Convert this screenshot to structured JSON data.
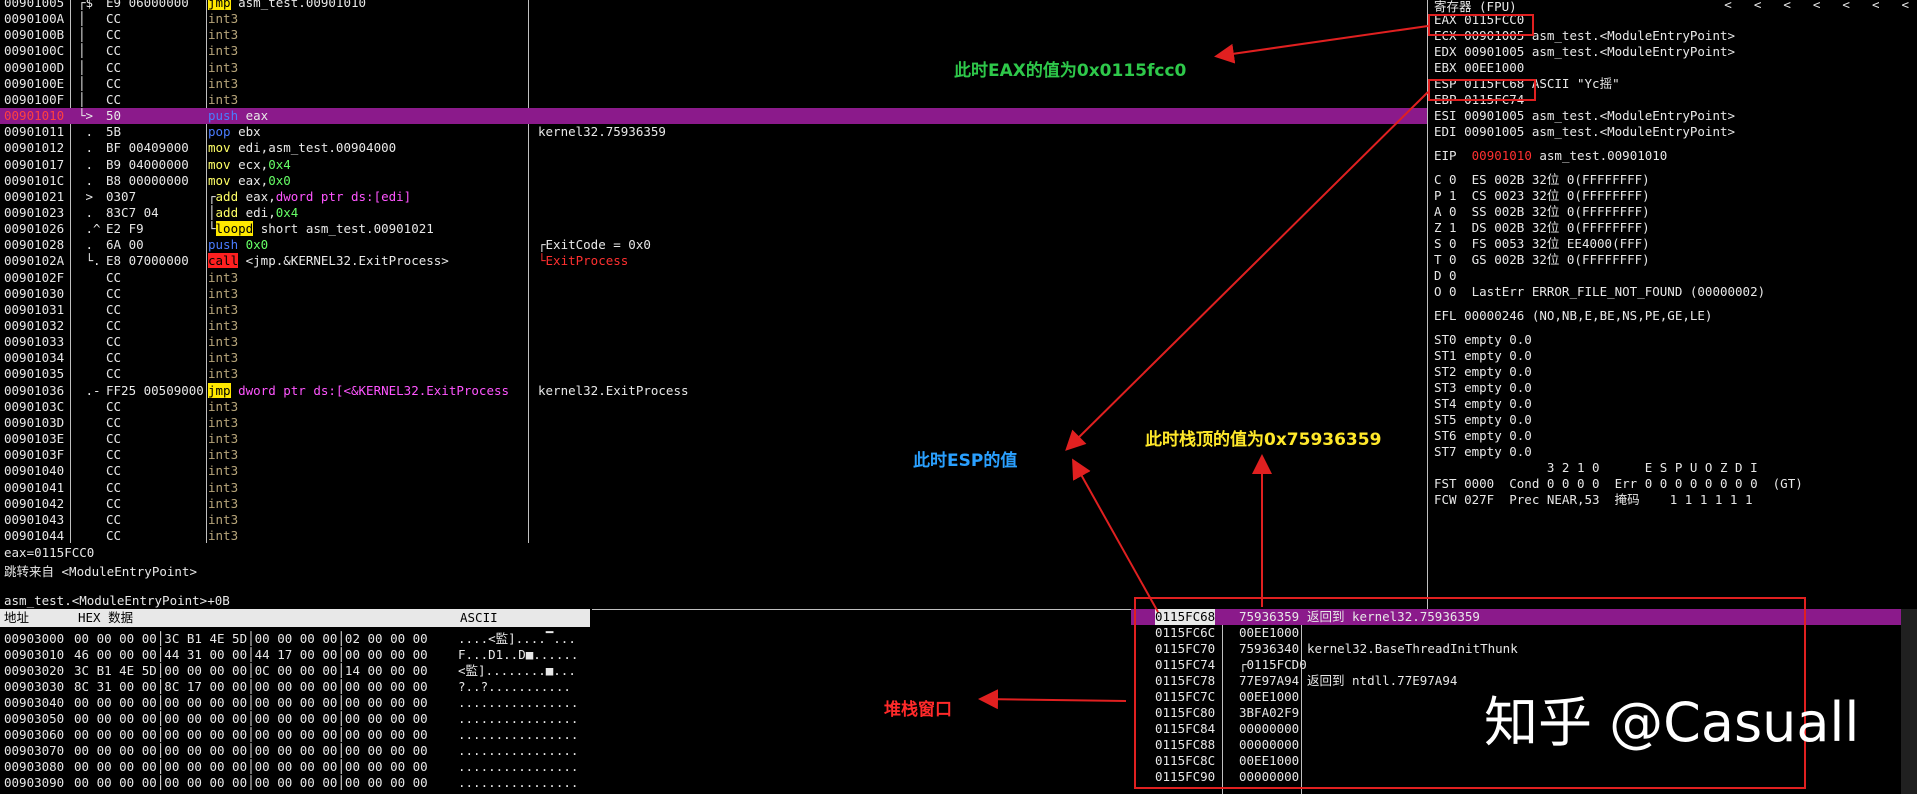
{
  "cpu": {
    "rows": [
      {
        "addr": "00901005",
        "mark": "┌$",
        "hex": "E9 06000000",
        "dis": [
          {
            "t": "jmp",
            "c": "kw-jmp"
          },
          {
            "t": " asm_test.00901010"
          }
        ],
        "com": ""
      },
      {
        "addr": "0090100A",
        "mark": "│",
        "hex": "CC",
        "dis": [
          {
            "t": "int3",
            "c": "kw-int"
          }
        ],
        "com": ""
      },
      {
        "addr": "0090100B",
        "mark": "│",
        "hex": "CC",
        "dis": [
          {
            "t": "int3",
            "c": "kw-int"
          }
        ],
        "com": ""
      },
      {
        "addr": "0090100C",
        "mark": "│",
        "hex": "CC",
        "dis": [
          {
            "t": "int3",
            "c": "kw-int"
          }
        ],
        "com": ""
      },
      {
        "addr": "0090100D",
        "mark": "│",
        "hex": "CC",
        "dis": [
          {
            "t": "int3",
            "c": "kw-int"
          }
        ],
        "com": ""
      },
      {
        "addr": "0090100E",
        "mark": "│",
        "hex": "CC",
        "dis": [
          {
            "t": "int3",
            "c": "kw-int"
          }
        ],
        "com": ""
      },
      {
        "addr": "0090100F",
        "mark": "│",
        "hex": "CC",
        "dis": [
          {
            "t": "int3",
            "c": "kw-int"
          }
        ],
        "com": ""
      },
      {
        "addr": "00901010",
        "mark": "└>",
        "hex": "50",
        "dis": [
          {
            "t": "push",
            "c": "kw-push"
          },
          {
            "t": " eax"
          }
        ],
        "com": "",
        "hl": true
      },
      {
        "addr": "00901011",
        "mark": " .",
        "hex": "5B",
        "dis": [
          {
            "t": "pop",
            "c": "kw-pop"
          },
          {
            "t": " ebx"
          }
        ],
        "com": "kernel32.75936359"
      },
      {
        "addr": "00901012",
        "mark": " .",
        "hex": "BF 00409000",
        "dis": [
          {
            "t": "mov",
            "c": "kw-mov"
          },
          {
            "t": " edi,asm_test.00904000"
          }
        ],
        "com": ""
      },
      {
        "addr": "00901017",
        "mark": " .",
        "hex": "B9 04000000",
        "dis": [
          {
            "t": "mov",
            "c": "kw-mov"
          },
          {
            "t": " ecx,"
          },
          {
            "t": "0x4",
            "c": "num"
          }
        ],
        "com": ""
      },
      {
        "addr": "0090101C",
        "mark": " .",
        "hex": "B8 00000000",
        "dis": [
          {
            "t": "mov",
            "c": "kw-mov"
          },
          {
            "t": " eax,"
          },
          {
            "t": "0x0",
            "c": "num"
          }
        ],
        "com": ""
      },
      {
        "addr": "00901021",
        "mark": " >",
        "hex": "0307",
        "dis": [
          {
            "t": "┌"
          },
          {
            "t": "add",
            "c": "kw-add"
          },
          {
            "t": " eax,"
          },
          {
            "t": "dword ptr ds:[edi]",
            "c": "mem"
          }
        ],
        "com": ""
      },
      {
        "addr": "00901023",
        "mark": " .",
        "hex": "83C7 04",
        "dis": [
          {
            "t": "│"
          },
          {
            "t": "add",
            "c": "kw-add"
          },
          {
            "t": " edi,"
          },
          {
            "t": "0x4",
            "c": "num"
          }
        ],
        "com": ""
      },
      {
        "addr": "00901026",
        "mark": " .^",
        "hex": "E2 F9",
        "dis": [
          {
            "t": "└"
          },
          {
            "t": "loopd",
            "c": "kw-loop"
          },
          {
            "t": " short asm_test.00901021"
          }
        ],
        "com": ""
      },
      {
        "addr": "00901028",
        "mark": " .",
        "hex": "6A 00",
        "dis": [
          {
            "t": "push",
            "c": "kw-push"
          },
          {
            "t": " 0x0",
            "c": "num"
          }
        ],
        "com": "┌ExitCode = 0x0"
      },
      {
        "addr": "0090102A",
        "mark": " └.",
        "hex": "E8 07000000",
        "dis": [
          {
            "t": "call",
            "c": "kw-call"
          },
          {
            "t": " <jmp.&KERNEL32.ExitProcess>"
          }
        ],
        "com": "└ExitProcess",
        "comred": true
      },
      {
        "addr": "0090102F",
        "mark": "",
        "hex": "CC",
        "dis": [
          {
            "t": "int3",
            "c": "kw-int"
          }
        ],
        "com": ""
      },
      {
        "addr": "00901030",
        "mark": "",
        "hex": "CC",
        "dis": [
          {
            "t": "int3",
            "c": "kw-int"
          }
        ],
        "com": ""
      },
      {
        "addr": "00901031",
        "mark": "",
        "hex": "CC",
        "dis": [
          {
            "t": "int3",
            "c": "kw-int"
          }
        ],
        "com": ""
      },
      {
        "addr": "00901032",
        "mark": "",
        "hex": "CC",
        "dis": [
          {
            "t": "int3",
            "c": "kw-int"
          }
        ],
        "com": ""
      },
      {
        "addr": "00901033",
        "mark": "",
        "hex": "CC",
        "dis": [
          {
            "t": "int3",
            "c": "kw-int"
          }
        ],
        "com": ""
      },
      {
        "addr": "00901034",
        "mark": "",
        "hex": "CC",
        "dis": [
          {
            "t": "int3",
            "c": "kw-int"
          }
        ],
        "com": ""
      },
      {
        "addr": "00901035",
        "mark": "",
        "hex": "CC",
        "dis": [
          {
            "t": "int3",
            "c": "kw-int"
          }
        ],
        "com": ""
      },
      {
        "addr": "00901036",
        "mark": " .-",
        "hex": "FF25 00509000",
        "dis": [
          {
            "t": "jmp",
            "c": "kw-jmp"
          },
          {
            "t": " dword ptr ds:[<&KERNEL32.ExitProcess",
            "c": "mem"
          }
        ],
        "com": "kernel32.ExitProcess"
      },
      {
        "addr": "0090103C",
        "mark": "",
        "hex": "CC",
        "dis": [
          {
            "t": "int3",
            "c": "kw-int"
          }
        ],
        "com": ""
      },
      {
        "addr": "0090103D",
        "mark": "",
        "hex": "CC",
        "dis": [
          {
            "t": "int3",
            "c": "kw-int"
          }
        ],
        "com": ""
      },
      {
        "addr": "0090103E",
        "mark": "",
        "hex": "CC",
        "dis": [
          {
            "t": "int3",
            "c": "kw-int"
          }
        ],
        "com": ""
      },
      {
        "addr": "0090103F",
        "mark": "",
        "hex": "CC",
        "dis": [
          {
            "t": "int3",
            "c": "kw-int"
          }
        ],
        "com": ""
      },
      {
        "addr": "00901040",
        "mark": "",
        "hex": "CC",
        "dis": [
          {
            "t": "int3",
            "c": "kw-int"
          }
        ],
        "com": ""
      },
      {
        "addr": "00901041",
        "mark": "",
        "hex": "CC",
        "dis": [
          {
            "t": "int3",
            "c": "kw-int"
          }
        ],
        "com": ""
      },
      {
        "addr": "00901042",
        "mark": "",
        "hex": "CC",
        "dis": [
          {
            "t": "int3",
            "c": "kw-int"
          }
        ],
        "com": ""
      },
      {
        "addr": "00901043",
        "mark": "",
        "hex": "CC",
        "dis": [
          {
            "t": "int3",
            "c": "kw-int"
          }
        ],
        "com": ""
      },
      {
        "addr": "00901044",
        "mark": "",
        "hex": "CC",
        "dis": [
          {
            "t": "int3",
            "c": "kw-int"
          }
        ],
        "com": ""
      }
    ]
  },
  "info": {
    "line1": "eax=0115FCC0",
    "line2": "跳转来自 <ModuleEntryPoint>",
    "line3": "asm_test.<ModuleEntryPoint>+0B"
  },
  "registers": {
    "title": "寄存器 (FPU)",
    "lines": [
      "EAX 0115FCC0",
      "ECX 00901005 asm_test.<ModuleEntryPoint>",
      "EDX 00901005 asm_test.<ModuleEntryPoint>",
      "EBX 00EE1000",
      "ESP 0115FC68 ASCII \"Yc摇\"",
      "EBP 0115FC74",
      "ESI 00901005 asm_test.<ModuleEntryPoint>",
      "EDI 00901005 asm_test.<ModuleEntryPoint>",
      "",
      "EIP_LINE",
      "",
      "C 0  ES 002B 32位 0(FFFFFFFF)",
      "P 1  CS 0023 32位 0(FFFFFFFF)",
      "A 0  SS 002B 32位 0(FFFFFFFF)",
      "Z 1  DS 002B 32位 0(FFFFFFFF)",
      "S 0  FS 0053 32位 EE4000(FFF)",
      "T 0  GS 002B 32位 0(FFFFFFFF)",
      "D 0",
      "O 0  LastErr ERROR_FILE_NOT_FOUND (00000002)",
      "",
      "EFL 00000246 (NO,NB,E,BE,NS,PE,GE,LE)",
      "",
      "ST0 empty 0.0",
      "ST1 empty 0.0",
      "ST2 empty 0.0",
      "ST3 empty 0.0",
      "ST4 empty 0.0",
      "ST5 empty 0.0",
      "ST6 empty 0.0",
      "ST7 empty 0.0",
      "               3 2 1 0      E S P U O Z D I",
      "FST 0000  Cond 0 0 0 0  Err 0 0 0 0 0 0 0 0  (GT)",
      "FCW 027F  Prec NEAR,53  掩码    1 1 1 1 1 1"
    ],
    "eip_label": "EIP",
    "eip_addr": "00901010",
    "eip_sym": "asm_test.00901010"
  },
  "dump": {
    "headers": [
      "地址",
      "HEX 数据",
      "ASCII"
    ],
    "rows": [
      {
        "addr": "00903000",
        "hex": "00 00 00 00│3C B1 4E 5D│00 00 00 00│02 00 00 00",
        "ascii": "....<監]....▔..."
      },
      {
        "addr": "00903010",
        "hex": "46 00 00 00│44 31 00 00│44 17 00 00│00 00 00 00",
        "ascii": "F...D1..D■......"
      },
      {
        "addr": "00903020",
        "hex": "3C B1 4E 5D│00 00 00 00│0C 00 00 00│14 00 00 00",
        "ascii": "<監]........■..."
      },
      {
        "addr": "00903030",
        "hex": "8C 31 00 00│8C 17 00 00│00 00 00 00│00 00 00 00",
        "ascii": "?..?..........."
      },
      {
        "addr": "00903040",
        "hex": "00 00 00 00│00 00 00 00│00 00 00 00│00 00 00 00",
        "ascii": "................"
      },
      {
        "addr": "00903050",
        "hex": "00 00 00 00│00 00 00 00│00 00 00 00│00 00 00 00",
        "ascii": "................"
      },
      {
        "addr": "00903060",
        "hex": "00 00 00 00│00 00 00 00│00 00 00 00│00 00 00 00",
        "ascii": "................"
      },
      {
        "addr": "00903070",
        "hex": "00 00 00 00│00 00 00 00│00 00 00 00│00 00 00 00",
        "ascii": "................"
      },
      {
        "addr": "00903080",
        "hex": "00 00 00 00│00 00 00 00│00 00 00 00│00 00 00 00",
        "ascii": "................"
      },
      {
        "addr": "00903090",
        "hex": "00 00 00 00│00 00 00 00│00 00 00 00│00 00 00 00",
        "ascii": "................"
      }
    ]
  },
  "stack": {
    "rows": [
      {
        "addr": "0115FC68",
        "val": "75936359",
        "com": "返回到 kernel32.75936359",
        "hl": true
      },
      {
        "addr": "0115FC6C",
        "val": "00EE1000",
        "com": ""
      },
      {
        "addr": "0115FC70",
        "val": "75936340",
        "com": "kernel32.BaseThreadInitThunk"
      },
      {
        "addr": "0115FC74",
        "val": "┌0115FCD0",
        "com": ""
      },
      {
        "addr": "0115FC78",
        "val": "77E97A94",
        "com": "返回到 ntdll.77E97A94"
      },
      {
        "addr": "0115FC7C",
        "val": "00EE1000",
        "com": ""
      },
      {
        "addr": "0115FC80",
        "val": "3BFA02F9",
        "com": ""
      },
      {
        "addr": "0115FC84",
        "val": "00000000",
        "com": ""
      },
      {
        "addr": "0115FC88",
        "val": "00000000",
        "com": ""
      },
      {
        "addr": "0115FC8C",
        "val": "00EE1000",
        "com": ""
      },
      {
        "addr": "0115FC90",
        "val": "00000000",
        "com": ""
      }
    ]
  },
  "annotations": {
    "eax_note": "此时EAX的值为0x0115fcc0",
    "esp_note": "此时ESP的值",
    "stacktop_note": "此时栈顶的值为0x75936359",
    "stack_window_note": "堆栈窗口",
    "colors": {
      "green": "#2ec84a",
      "blue": "#2aa0ff",
      "yellow": "#ffe82a",
      "red": "#ff2a2a"
    }
  },
  "watermark": "知乎 @Casuall",
  "toolbar": {
    "arrows": [
      "<",
      "<",
      "<",
      "<",
      "<",
      "<",
      "<"
    ]
  }
}
